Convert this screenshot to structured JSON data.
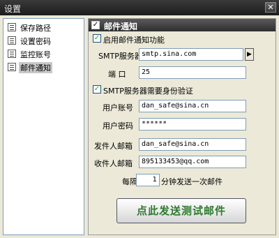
{
  "window": {
    "title": "设置",
    "close_glyph": "✕"
  },
  "sidebar": {
    "items": [
      {
        "label": "保存路径",
        "icon": "list-icon"
      },
      {
        "label": "设置密码",
        "icon": "list-icon"
      },
      {
        "label": "监控账号",
        "icon": "list-icon"
      },
      {
        "label": "邮件通知",
        "icon": "list-icon",
        "selected": true
      }
    ]
  },
  "panel": {
    "title": "邮件通知",
    "head_checked": true,
    "enable_label": "启用邮件通知功能",
    "enable_checked": true,
    "smtp_label": "SMTP服务器",
    "smtp_value": "smtp.sina.com",
    "port_label": "端  口",
    "port_value": "25",
    "auth_label": "SMTP服务器需要身份验证",
    "auth_checked": true,
    "account_label": "用户账号",
    "account_value": "dan_safe@sina.cn",
    "password_label": "用户密码",
    "password_value": "******",
    "sender_label": "发件人邮箱",
    "sender_value": "dan_safe@sina.cn",
    "recipient_label": "收件人邮箱",
    "recipient_value": "895133453@qq.com",
    "interval_prefix": "每隔",
    "interval_value": "1",
    "interval_suffix": "分钟发送一次邮件",
    "send_button": "点此发送测试邮件"
  },
  "colors": {
    "check_mark": "#21a121",
    "send_text": "#2f7a2f",
    "title_bar": "#2a2a2a"
  }
}
